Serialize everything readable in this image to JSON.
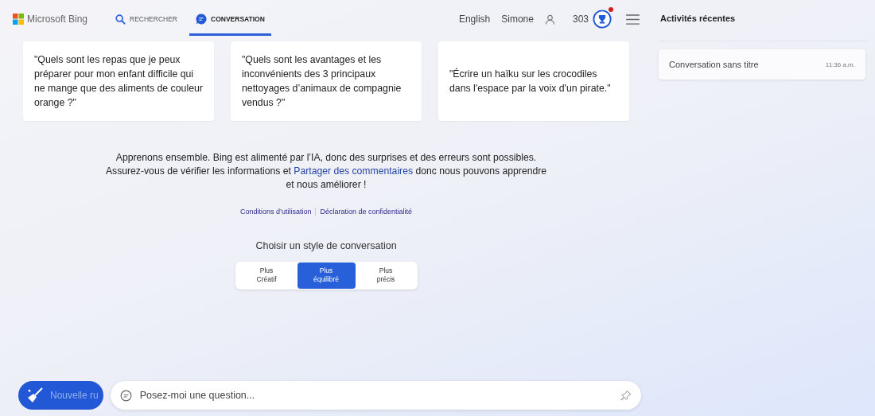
{
  "header": {
    "logo": "Microsoft Bing",
    "tabs": [
      {
        "label": "RECHERCHER",
        "kind": "search",
        "selected": false
      },
      {
        "label": "CONVERSATION",
        "kind": "chat",
        "selected": true
      }
    ],
    "language": "English",
    "user": "Simone",
    "points": "303",
    "rewards_notification": true
  },
  "suggestions": [
    "\"Quels sont les repas que je peux préparer pour mon enfant difficile qui ne mange que des aliments de couleur orange ?\"",
    "\"Quels sont les avantages et les inconvénients des 3 principaux nettoyages d’animaux de compagnie vendus ?\"",
    "\"Écrire un haïku sur les crocodiles dans l'espace par la voix d'un pirate.\""
  ],
  "disclaimer": {
    "line1": "Apprenons ensemble. Bing est alimenté par l’IA, donc des surprises et des erreurs sont possibles.",
    "before_link": "Assurez-vous de vérifier les informations et",
    "link": "Partager des commentaires",
    "after_link": "donc nous pouvons apprendre et nous améliorer !"
  },
  "legal_links": [
    "Conditions d’utilisation",
    "Déclaration de confidentialité"
  ],
  "style_picker": {
    "title": "Choisir un style de conversation",
    "options": [
      {
        "line1": "Plus",
        "line2": "Créatif",
        "selected": false
      },
      {
        "line1": "Plus",
        "line2": "équilibré",
        "selected": true
      },
      {
        "line1": "Plus",
        "line2": "précis",
        "selected": false
      }
    ]
  },
  "composer": {
    "new_topic": "Nouvelle ru",
    "placeholder": "Posez-moi une question..."
  },
  "sidebar": {
    "title": "Activités récentes",
    "items": [
      {
        "title": "Conversation sans titre",
        "time": "11:36 a.m."
      }
    ]
  }
}
